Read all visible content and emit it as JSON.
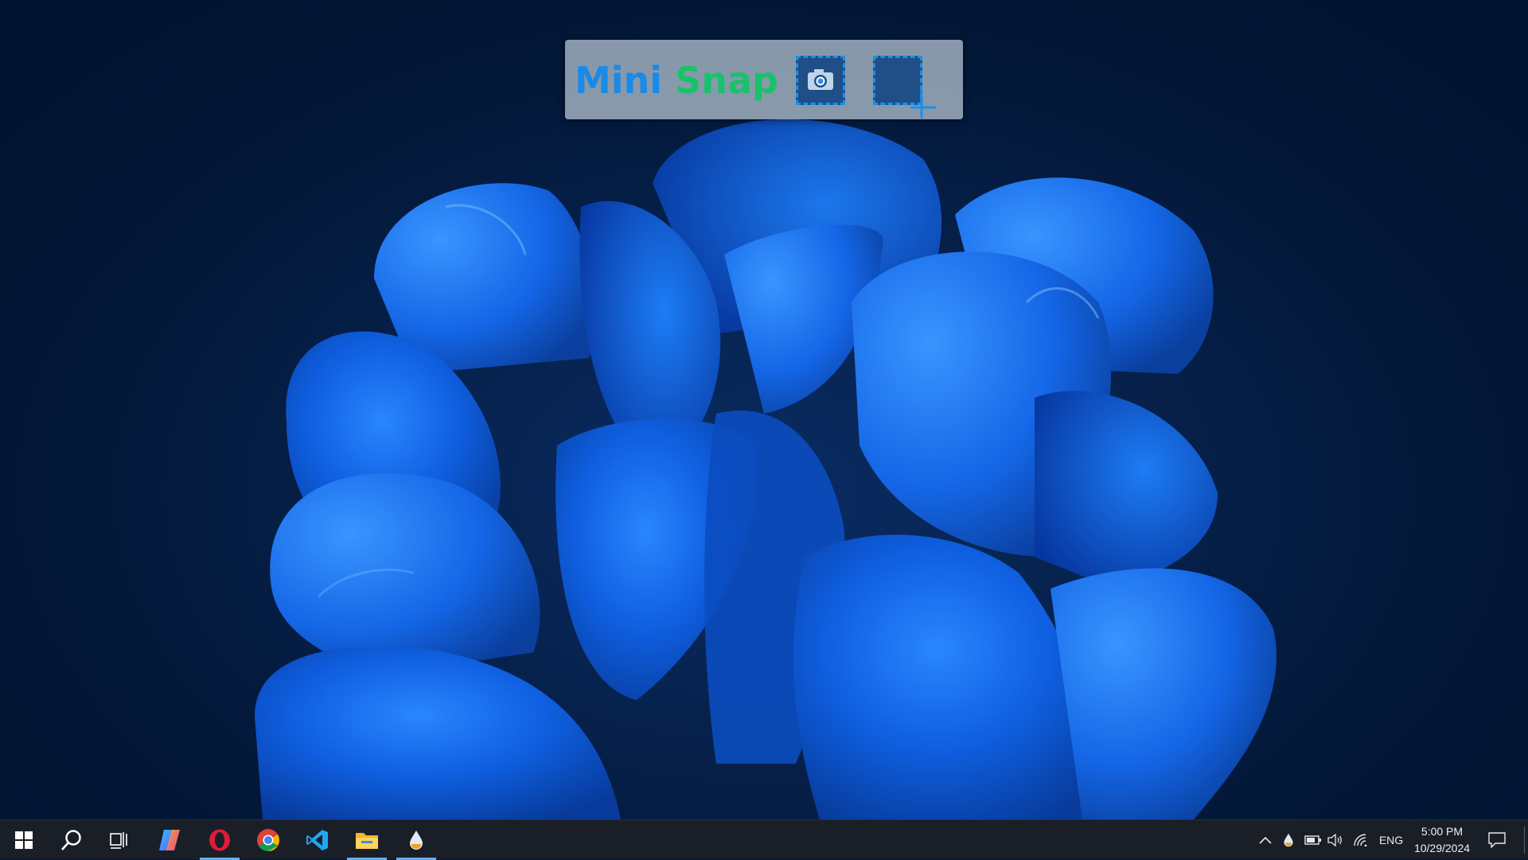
{
  "widget": {
    "title_part1": "Mini",
    "title_part2": "Snap",
    "buttons": [
      {
        "name": "camera-icon",
        "action": "capture-screen"
      },
      {
        "name": "region-select-icon",
        "action": "capture-region"
      }
    ]
  },
  "taskbar": {
    "pinned": [
      {
        "name": "start-button",
        "icon": "windows-logo-icon",
        "active": false
      },
      {
        "name": "search-button",
        "icon": "search-icon",
        "active": false
      },
      {
        "name": "task-view-button",
        "icon": "task-view-icon",
        "active": false
      },
      {
        "name": "copilot-button",
        "icon": "copilot-icon",
        "active": false
      },
      {
        "name": "opera-button",
        "icon": "opera-icon",
        "active": true
      },
      {
        "name": "chrome-button",
        "icon": "chrome-icon",
        "active": false
      },
      {
        "name": "vscode-button",
        "icon": "vscode-icon",
        "active": false
      },
      {
        "name": "file-explorer-button",
        "icon": "folder-icon",
        "active": true
      },
      {
        "name": "mini-snap-button",
        "icon": "droplet-icon",
        "active": true
      }
    ],
    "tray": {
      "language": "ENG",
      "time": "5:00 PM",
      "date": "10/29/2024"
    }
  },
  "colors": {
    "title_mini": "#1a8ae6",
    "title_snap": "#19c26a",
    "accent": "#66aef5",
    "taskbar_bg": "#1a1f27"
  }
}
